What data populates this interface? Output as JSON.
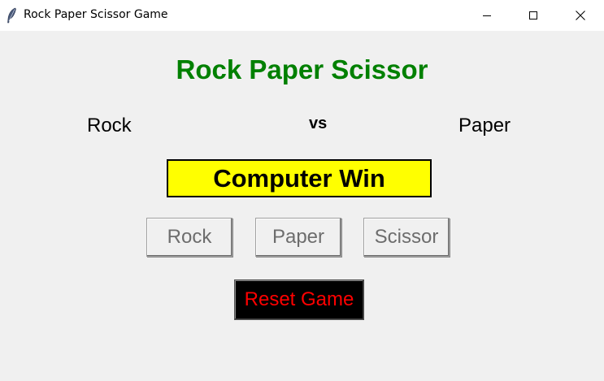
{
  "window": {
    "title": "Rock Paper Scissor Game",
    "icon": "feather-icon",
    "controls": [
      "minimize-icon",
      "maximize-icon",
      "close-icon"
    ]
  },
  "app": {
    "heading": "Rock Paper Scissor",
    "user_choice": "Rock",
    "vs_label": "vs",
    "computer_choice": "Paper",
    "result": "Computer Win"
  },
  "buttons": {
    "rock": "Rock",
    "paper": "Paper",
    "scissor": "Scissor",
    "reset": "Reset Game"
  },
  "colors": {
    "heading": "#008000",
    "result_bg": "#ffff00",
    "reset_bg": "#000000",
    "reset_text": "#ff0000",
    "button_text": "#6d6d6d",
    "background": "#f0f0f0"
  }
}
